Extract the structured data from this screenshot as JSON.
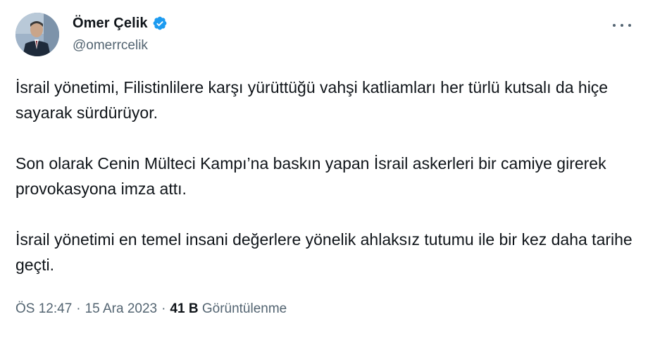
{
  "author": {
    "display_name": "Ömer Çelik",
    "handle": "@omerrcelik",
    "verified": true,
    "verified_color": "#1d9bf0"
  },
  "tweet": {
    "paragraphs": [
      "İsrail yönetimi, Filistinlilere karşı yürüttüğü vahşi katliamları her türlü kutsalı da hiçe sayarak sürdürüyor.",
      "Son olarak Cenin Mülteci Kampı’na baskın yapan İsrail askerleri bir camiye girerek provokasyona imza attı.",
      "İsrail yönetimi en temel insani değerlere yönelik ahlaksız tutumu ile bir kez daha tarihe geçti."
    ]
  },
  "meta": {
    "time": "ÖS 12:47",
    "date": "15 Ara 2023",
    "views_count": "41 B",
    "views_label": "Görüntülenme",
    "separator": "·"
  },
  "icons": {
    "more": "more-horizontal-icon",
    "verified": "verified-badge-icon"
  }
}
